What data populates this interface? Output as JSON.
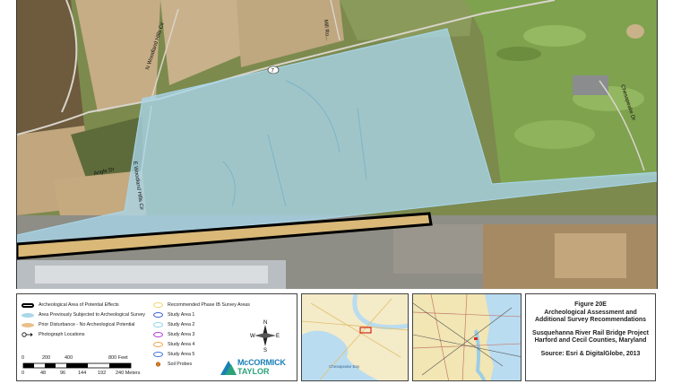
{
  "map": {
    "road_labels": [
      "7",
      "Mill Ro...",
      "N Woodland Hills Cir",
      "Angle Dr",
      "E Woodland Hills Cir",
      "Chesapeake Dr"
    ]
  },
  "legend": {
    "items": [
      {
        "label": "Archeological Area of Potential Effects",
        "symbol": "black-outline-bar"
      },
      {
        "label": "Area Previously Subjected to Archeological Survey",
        "symbol": "light-blue-fill",
        "color": "#a9d6ea"
      },
      {
        "label": "Prior Disturbance - No Archeological Potential",
        "symbol": "tan-fill",
        "color": "#e8c08a"
      },
      {
        "label": "Photograph Locations",
        "symbol": "arrow-circle-icon"
      },
      {
        "label": "Recommended Phase IB Survey Areas",
        "symbol": "ellipse",
        "color": "#f2d66b"
      },
      {
        "label": "Study Area 1",
        "symbol": "ellipse",
        "color": "#3a5bd9"
      },
      {
        "label": "Study Area 2",
        "symbol": "ellipse",
        "color": "#8fd3e8"
      },
      {
        "label": "Study Area 3",
        "symbol": "ellipse",
        "color": "#b13ad4"
      },
      {
        "label": "Study Area 4",
        "symbol": "ellipse",
        "color": "#f0a64a"
      },
      {
        "label": "Study Area 5",
        "symbol": "ellipse",
        "color": "#3a70d9"
      },
      {
        "label": "Soil Probes",
        "symbol": "dot-icon",
        "color": "#e07b1a"
      }
    ],
    "north_arrow": {
      "n": "N",
      "s": "S",
      "e": "E",
      "w": "W"
    },
    "scale_feet": [
      "0",
      "200",
      "400",
      "800 Feet"
    ],
    "scale_meters": [
      "0",
      "48",
      "96",
      "144",
      "192",
      "240 Meters"
    ],
    "logo": {
      "line1": "McCORMICK",
      "line2": "TAYLOR"
    }
  },
  "insets": {
    "locator1": {
      "labels": [
        "Chesapeake Bay"
      ]
    },
    "locator2": {
      "labels": []
    }
  },
  "title_block": {
    "figure": "Figure 20E",
    "title_line1": "Archeological Assessment and",
    "title_line2": "Additional Survey Recommendations",
    "project_line1": "Susquehanna River Rail Bridge Project",
    "project_line2": "Harford and Cecil Counties, Maryland",
    "source": "Source: Esri & DigitalGlobe, 2013"
  }
}
